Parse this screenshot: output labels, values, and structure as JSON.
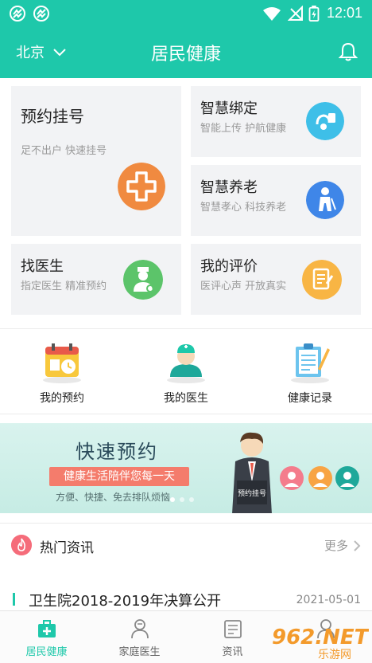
{
  "status_bar": {
    "time": "12:01"
  },
  "header": {
    "city": "北京",
    "title": "居民健康"
  },
  "services": [
    {
      "title": "预约挂号",
      "subtitle": "足不出户 快速挂号",
      "icon": "hospital-cross-icon",
      "color": "#f08a40"
    },
    {
      "title": "智慧绑定",
      "subtitle": "智能上传 护航健康",
      "icon": "smart-binding-icon",
      "color": "#3ebfe8"
    },
    {
      "title": "智慧养老",
      "subtitle": "智慧孝心 科技养老",
      "icon": "elderly-icon",
      "color": "#3f86e8"
    },
    {
      "title": "找医生",
      "subtitle": "指定医生 精准预约",
      "icon": "doctor-icon",
      "color": "#5cc46a"
    },
    {
      "title": "我的评价",
      "subtitle": "医评心声 开放真实",
      "icon": "review-icon",
      "color": "#f8b544"
    }
  ],
  "quick_links": [
    {
      "label": "我的预约",
      "icon": "calendar-icon"
    },
    {
      "label": "我的医生",
      "icon": "nurse-icon"
    },
    {
      "label": "健康记录",
      "icon": "clipboard-icon"
    }
  ],
  "banner": {
    "title": "快速预约",
    "ribbon": "健康生活陪伴您每一天",
    "subtitle": "方便、快捷、免去排队烦恼",
    "sign_text": "预约挂号"
  },
  "news": {
    "section_title": "热门资讯",
    "more_label": "更多",
    "items": [
      {
        "title": "卫生院2018-2019年决算公开",
        "date": "2021-05-01"
      }
    ]
  },
  "tabs": [
    {
      "label": "居民健康",
      "icon": "medical-kit-icon",
      "active": true
    },
    {
      "label": "家庭医生",
      "icon": "family-doctor-icon",
      "active": false
    },
    {
      "label": "资讯",
      "icon": "news-icon",
      "active": false
    },
    {
      "label": "",
      "icon": "person-icon",
      "active": false
    }
  ],
  "watermark": {
    "text": "962.NET",
    "sub": "乐游网"
  },
  "colors": {
    "primary": "#1ec8aa",
    "card_bg": "#f2f3f5"
  }
}
